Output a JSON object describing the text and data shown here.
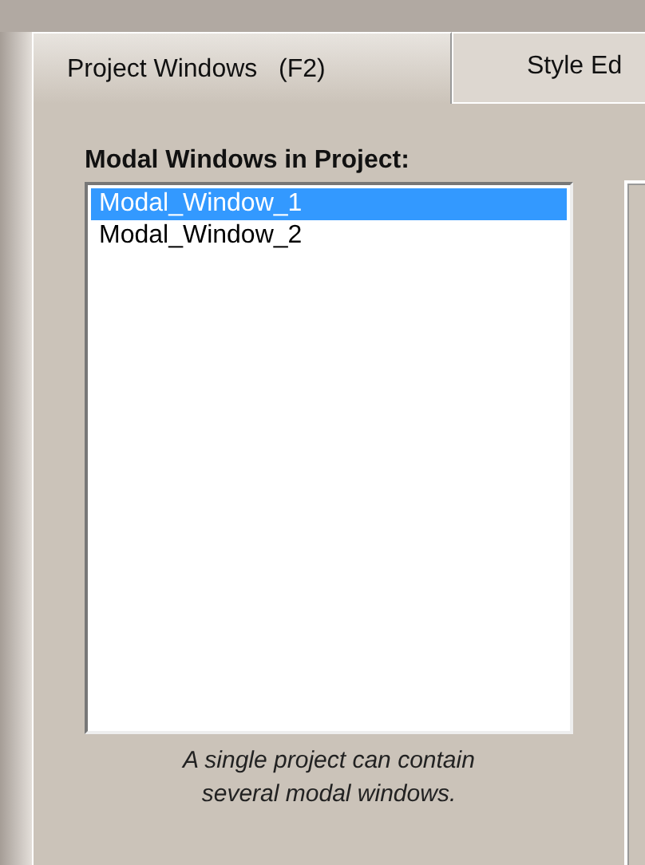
{
  "tabs": [
    {
      "label": "Project Windows   (F2)",
      "selected": true
    },
    {
      "label": "Style Ed",
      "selected": false
    }
  ],
  "modal_windows": {
    "heading": "Modal Windows in Project:",
    "items": [
      {
        "label": "Modal_Window_1",
        "selected": true
      },
      {
        "label": "Modal_Window_2",
        "selected": false
      }
    ],
    "caption": "A single project can contain several modal windows."
  }
}
